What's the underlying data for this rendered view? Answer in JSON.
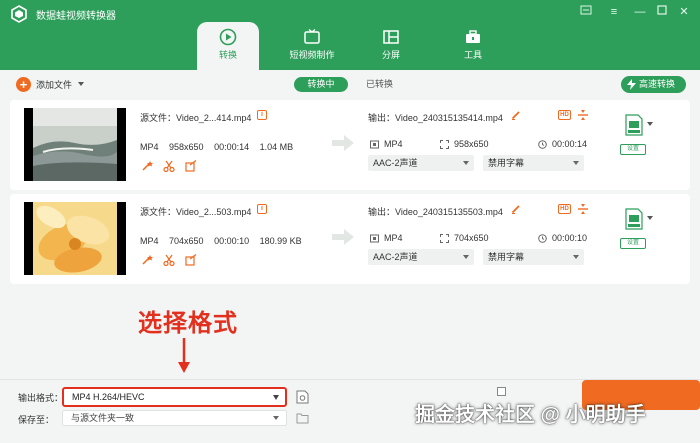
{
  "app": {
    "title": "数据蛙视频转换器"
  },
  "window_controls": [
    "minimize-to-tray-icon",
    "menu-icon",
    "minimize-icon",
    "maximize-icon",
    "close-icon"
  ],
  "tabs": [
    {
      "label": "转换",
      "icon": "convert-icon",
      "active": true
    },
    {
      "label": "短视频制作",
      "icon": "tv-icon",
      "active": false
    },
    {
      "label": "分屏",
      "icon": "split-screen-icon",
      "active": false
    },
    {
      "label": "工具",
      "icon": "toolbox-icon",
      "active": false
    }
  ],
  "toolbar": {
    "add_file_label": "添加文件",
    "seg_converting": "转换中",
    "seg_converted": "已转换",
    "fast_convert_label": "高速转换"
  },
  "files": [
    {
      "source": "源文件：Video_2...414.mp4",
      "format": "MP4",
      "resolution": "958x650",
      "duration": "00:00:14",
      "size": "1.04 MB",
      "output_name": "输出：Video_240315135414.mp4",
      "out_format": "MP4",
      "out_resolution": "958x650",
      "out_duration": "00:00:14",
      "audio": "AAC-2声道",
      "subtitle": "禁用字幕",
      "settings_label": "设置"
    },
    {
      "source": "源文件：Video_2...503.mp4",
      "format": "MP4",
      "resolution": "704x650",
      "duration": "00:00:10",
      "size": "180.99 KB",
      "output_name": "输出：Video_240315135503.mp4",
      "out_format": "MP4",
      "out_resolution": "704x650",
      "out_duration": "00:00:10",
      "audio": "AAC-2声道",
      "subtitle": "禁用字幕",
      "settings_label": "设置"
    }
  ],
  "annotation": {
    "text": "选择格式"
  },
  "bottom": {
    "output_format_label": "输出格式：",
    "output_format_value": "MP4 H.264/HEVC",
    "save_to_label": "保存至：",
    "save_to_value": "与源文件夹一致"
  },
  "watermark": "掘金技术社区 @ 小明助手",
  "colors": {
    "brand_green": "#2e9e5b",
    "accent_orange": "#f06a21",
    "annotation_red": "#e3301e"
  }
}
